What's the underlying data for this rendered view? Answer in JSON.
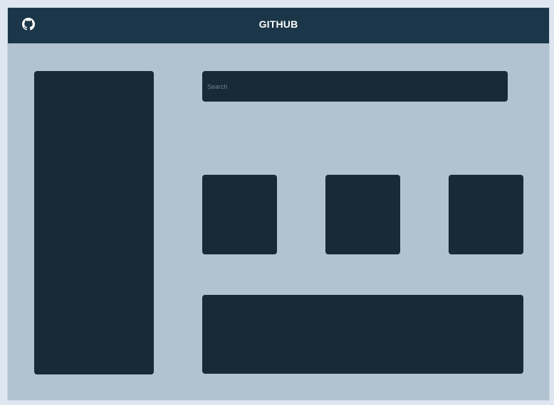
{
  "header": {
    "title": "GITHUB",
    "icon": "github-icon"
  },
  "search": {
    "placeholder": "Search",
    "value": ""
  },
  "colors": {
    "header_bg": "#1a3648",
    "page_bg": "#b3c2d1",
    "panel_bg": "#182a38",
    "title_text": "#ffffff"
  }
}
